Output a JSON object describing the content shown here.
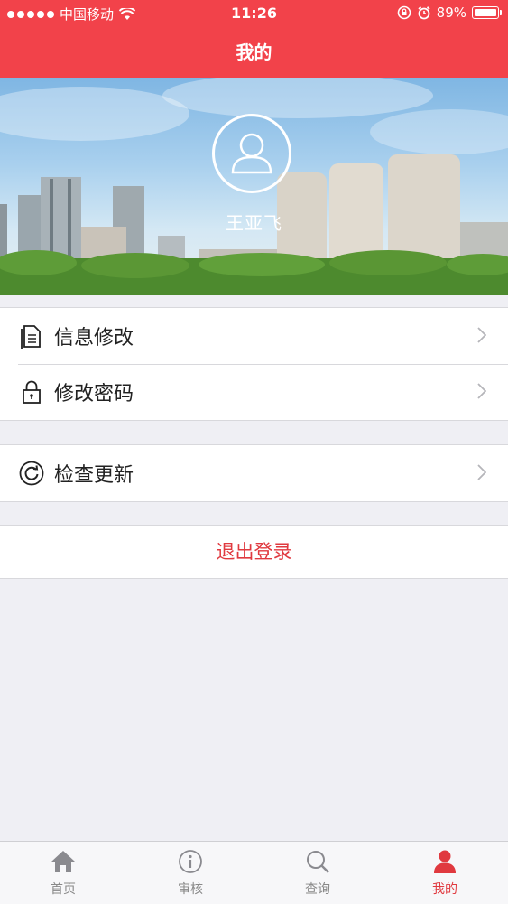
{
  "status_bar": {
    "carrier": "中国移动",
    "time": "11:26",
    "battery": "89%",
    "battery_level": 0.89
  },
  "nav": {
    "title": "我的"
  },
  "profile": {
    "username": "王亚飞",
    "avatar_icon": "user-avatar-icon"
  },
  "menu": {
    "groups": [
      {
        "items": [
          {
            "label": "信息修改",
            "icon": "document-icon"
          },
          {
            "label": "修改密码",
            "icon": "lock-icon"
          }
        ]
      },
      {
        "items": [
          {
            "label": "检查更新",
            "icon": "refresh-icon"
          }
        ]
      }
    ],
    "logout_label": "退出登录"
  },
  "tabbar": {
    "tabs": [
      {
        "label": "首页",
        "icon": "home-icon",
        "active": false
      },
      {
        "label": "审核",
        "icon": "info-icon",
        "active": false
      },
      {
        "label": "查询",
        "icon": "search-icon",
        "active": false
      },
      {
        "label": "我的",
        "icon": "person-icon",
        "active": true
      }
    ]
  },
  "colors": {
    "accent": "#f2424a",
    "logout_text": "#e0393f",
    "background": "#efeff4"
  }
}
